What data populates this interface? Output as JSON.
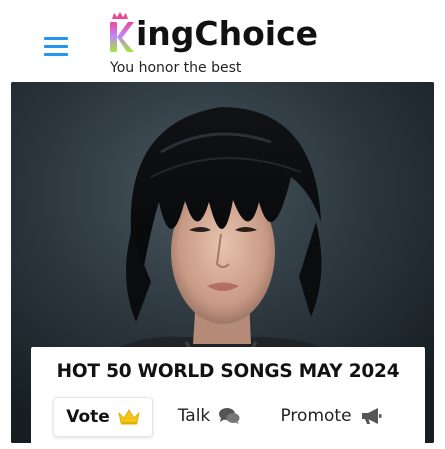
{
  "header": {
    "brand_k": "K",
    "brand_rest": "ingChoice",
    "tagline": "You honor the best"
  },
  "colors": {
    "menu_icon": "#2196f3",
    "logo_k_gradient_top": "#ec4899",
    "logo_k_gradient_bottom": "#a3e635",
    "crown": "#f5c518",
    "icon_gray": "#555555"
  },
  "card": {
    "title": "HOT 50 WORLD SONGS MAY 2024",
    "actions": {
      "vote": "Vote",
      "talk": "Talk",
      "promote": "Promote"
    }
  },
  "icons": [
    "menu-icon",
    "crown-icon",
    "chat-bubbles-icon",
    "megaphone-icon"
  ]
}
